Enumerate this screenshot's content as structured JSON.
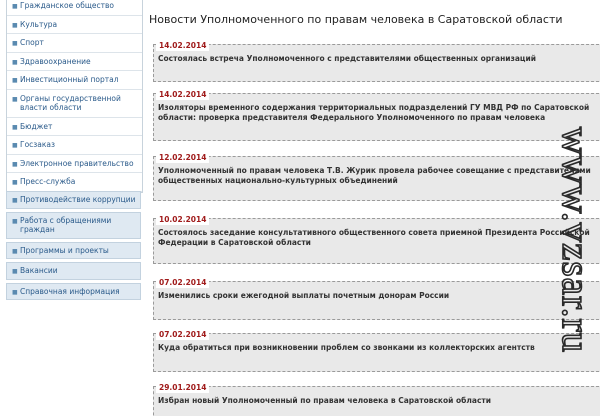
{
  "sidebar": {
    "menu1": [
      "Гражданское общество",
      "Культура",
      "Спорт",
      "Здравоохранение",
      "Инвестиционный портал",
      "Органы государственной власти области",
      "Бюджет",
      "Госзаказ",
      "Электронное правительство",
      "Пресс-служба"
    ],
    "menu2": [
      "Противодействие коррупции",
      "Работа с обращениями граждан",
      "Программы и проекты",
      "Вакансии",
      "Справочная информация"
    ]
  },
  "main": {
    "title": "Новости Уполномоченного по правам человека в Саратовской области",
    "news": [
      {
        "date": "14.02.2014",
        "text": "Состоялась встреча Уполномоченного с представителями общественных организаций"
      },
      {
        "date": "14.02.2014",
        "text": "Изоляторы временного содержания территориальных подразделений ГУ МВД РФ по Саратовской области: проверка представителя Федерального Уполномоченного по правам человека"
      },
      {
        "date": "12.02.2014",
        "text": "Уполномоченный по правам человека Т.В. Журик провела рабочее совещание с представителями общественных национально-культурных объединений"
      },
      {
        "date": "10.02.2014",
        "text": "Состоялось заседание консультативного общественного совета приемной Президента Российской Федерации в Саратовской области"
      },
      {
        "date": "07.02.2014",
        "text": "Изменились сроки ежегодной выплаты почетным донорам России"
      },
      {
        "date": "07.02.2014",
        "text": "Куда обратиться при возникновении проблем со звонками из коллекторских агентств"
      },
      {
        "date": "29.01.2014",
        "text": "Избран новый Уполномоченный по правам человека в Саратовской области"
      }
    ]
  },
  "watermark": {
    "text": "www.vzsar.ru",
    "color": "#2a2a2a"
  },
  "colors": {
    "date": "#a01b1b",
    "link": "#2a5a8a",
    "news_bg": "#e9e9e9"
  }
}
